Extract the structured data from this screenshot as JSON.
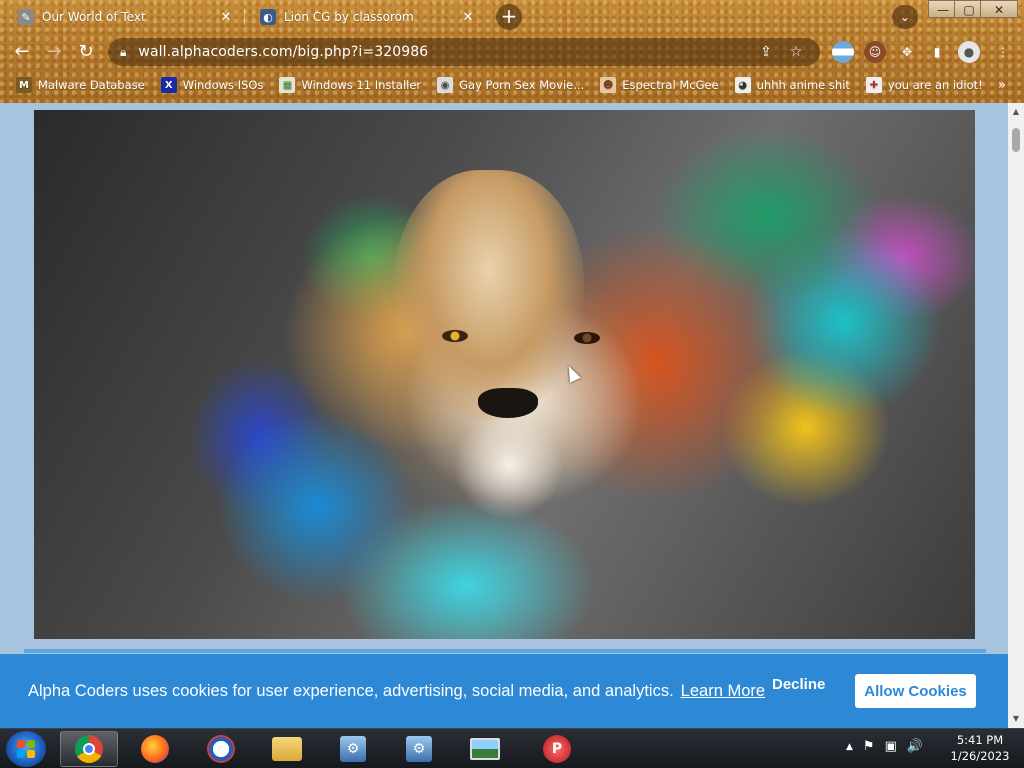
{
  "browser": {
    "tabs": [
      {
        "title": "Our World of Text",
        "close": "✕"
      },
      {
        "title": "Lion CG by classorom",
        "close": "✕"
      }
    ],
    "new_tab": "+",
    "tab_search": "⌄",
    "window_controls": {
      "minimize": "—",
      "maximize": "▢",
      "close": "✕"
    },
    "url": "wall.alphacoders.com/big.php?i=320986",
    "bookmarks": [
      {
        "label": "Malware Database",
        "icon": "M",
        "color": "#7a5a1e"
      },
      {
        "label": "Windows ISOs",
        "icon": "X",
        "color": "#1a2aa8"
      },
      {
        "label": "Windows 11 Installer",
        "icon": "▦",
        "color": "#4a8a3a"
      },
      {
        "label": "Gay Porn Sex Movie...",
        "icon": "◉",
        "color": "#4a4a4a"
      },
      {
        "label": "Espectral McGee",
        "icon": "☻",
        "color": "#6b3d1a"
      },
      {
        "label": "uhhh anime shit",
        "icon": "◕",
        "color": "#333333"
      },
      {
        "label": "you are an idiot!",
        "icon": "✚",
        "color": "#b03030"
      }
    ],
    "bookmarks_more": "»"
  },
  "page": {
    "cookie_text": "Alpha Coders uses cookies for user experience, advertising, social media, and analytics.",
    "learn_more": "Learn More",
    "decline": "Decline",
    "allow": "Allow Cookies"
  },
  "scroll": {
    "up": "▲",
    "down": "▼"
  },
  "taskbar": {
    "apps": [
      "chrome",
      "firefox",
      "opera",
      "file-explorer",
      "installer-1",
      "installer-2",
      "photo-viewer",
      "pinball"
    ],
    "tray": {
      "chevron": "▲",
      "flag": "⚑",
      "network": "▣",
      "volume": "🔊"
    },
    "time": "5:41 PM",
    "date": "1/26/2023"
  },
  "colors": {
    "cookie_bar": "#2d88d6",
    "page_bg": "#a7c3dd",
    "chrome": "#b57a2c"
  }
}
